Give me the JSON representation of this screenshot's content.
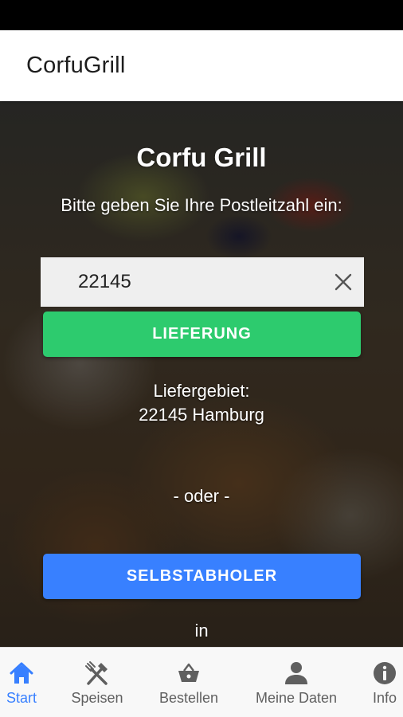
{
  "app_bar": {
    "title": "CorfuGrill"
  },
  "hero": {
    "title": "Corfu Grill",
    "prompt": "Bitte geben Sie Ihre Postleitzahl ein:",
    "zip_value": "22145",
    "delivery_button": "LIEFERUNG",
    "area_label": "Liefergebiet:",
    "area_value": "22145 Hamburg",
    "or_text": "- oder -",
    "pickup_button": "SELBSTABHOLER",
    "in_text": "in"
  },
  "tabs": [
    {
      "label": "Start",
      "icon": "home-icon",
      "active": true
    },
    {
      "label": "Speisen",
      "icon": "utensils-icon"
    },
    {
      "label": "Bestellen",
      "icon": "basket-icon"
    },
    {
      "label": "Meine Daten",
      "icon": "person-icon"
    },
    {
      "label": "Info",
      "icon": "info-icon"
    }
  ],
  "colors": {
    "accent": "#3880ff",
    "delivery": "#2dcb6e",
    "pickup": "#3880ff"
  }
}
